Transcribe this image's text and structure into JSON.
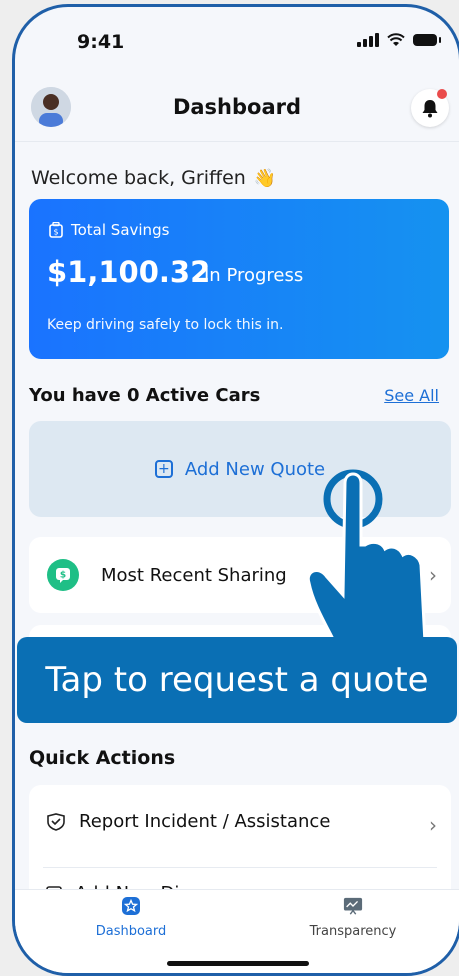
{
  "status": {
    "time": "9:41"
  },
  "header": {
    "title": "Dashboard"
  },
  "welcome": {
    "text": "Welcome back, Griffen",
    "emoji": "👋"
  },
  "savings": {
    "label": "Total Savings",
    "amount": "$1,100.32",
    "status": "In Progress",
    "note": "Keep driving safely to lock this in."
  },
  "cars": {
    "title": "You have 0 Active Cars",
    "see_all": "See All"
  },
  "add_quote": {
    "label": "Add New Quote"
  },
  "sharing": {
    "label": "Most Recent Sharing"
  },
  "tooltip": {
    "text": "Tap to request a quote"
  },
  "quick_actions": {
    "title": "Quick Actions",
    "items": [
      {
        "label": "Report Incident / Assistance"
      },
      {
        "label": "Add New Di..."
      }
    ]
  },
  "nav": {
    "items": [
      {
        "label": "Dashboard",
        "icon": "star-shield-icon"
      },
      {
        "label": "Transparency",
        "icon": "chart-icon"
      }
    ]
  },
  "colors": {
    "primary": "#1d6fd6",
    "card_gradient_start": "#1a73ff",
    "tooltip_bg": "#0a6fb4",
    "share_green": "#1fbf86"
  }
}
